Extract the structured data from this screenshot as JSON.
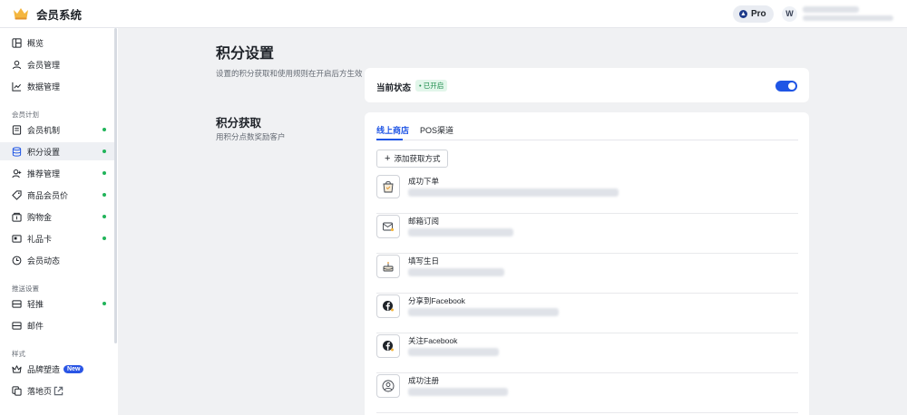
{
  "header": {
    "app_title": "会员系统",
    "plan_badge": "Pro",
    "avatar_initial": "W"
  },
  "sidebar": {
    "items": [
      {
        "key": "overview",
        "label": "概览",
        "icon": "dashboard-icon"
      },
      {
        "key": "members",
        "label": "会员管理",
        "icon": "user-icon"
      },
      {
        "key": "data",
        "label": "数据管理",
        "icon": "chart-line-icon"
      }
    ],
    "group_plan": "会员计划",
    "plan_items": [
      {
        "key": "mechanism",
        "label": "会员机制",
        "icon": "document-icon",
        "dot": true
      },
      {
        "key": "points",
        "label": "积分设置",
        "icon": "database-icon",
        "dot": true,
        "active": true
      },
      {
        "key": "referral",
        "label": "推荐管理",
        "icon": "user-plus-icon",
        "dot": true
      },
      {
        "key": "member-price",
        "label": "商品会员价",
        "icon": "tag-icon",
        "dot": true
      },
      {
        "key": "shopping-credit",
        "label": "购物金",
        "icon": "wallet-icon",
        "dot": true
      },
      {
        "key": "gift-card",
        "label": "礼品卡",
        "icon": "gift-card-icon",
        "dot": true
      },
      {
        "key": "activity",
        "label": "会员动态",
        "icon": "clock-icon",
        "dot": false
      }
    ],
    "group_push": "推送设置",
    "push_items": [
      {
        "key": "light-push",
        "label": "轻推",
        "icon": "message-icon",
        "dot": true
      },
      {
        "key": "email",
        "label": "邮件",
        "icon": "mail-icon",
        "dot": false
      }
    ],
    "group_style": "样式",
    "style_items": [
      {
        "key": "brand",
        "label": "品牌塑造",
        "icon": "crown-icon",
        "badge": "New"
      },
      {
        "key": "landing",
        "label": "落地页",
        "icon": "pages-icon",
        "external": true
      }
    ]
  },
  "page": {
    "title": "积分设置",
    "description": "设置的积分获取和使用规则在开启后方生效",
    "status_label": "当前状态",
    "status_badge": "• 已开启",
    "status_enabled": true,
    "earn_title": "积分获取",
    "earn_description": "用积分点数奖励客户",
    "tabs": [
      {
        "label": "线上商店",
        "active": true
      },
      {
        "label": "POS渠道",
        "active": false
      }
    ],
    "add_button": "添加获取方式",
    "rules": [
      {
        "title": "成功下单",
        "icon": "shopping-bag-icon"
      },
      {
        "title": "邮箱订阅",
        "icon": "mail-icon"
      },
      {
        "title": "填写生日",
        "icon": "cake-icon"
      },
      {
        "title": "分享到Facebook",
        "icon": "facebook-icon"
      },
      {
        "title": "关注Facebook",
        "icon": "facebook-icon"
      },
      {
        "title": "成功注册",
        "icon": "user-circle-icon"
      }
    ]
  }
}
